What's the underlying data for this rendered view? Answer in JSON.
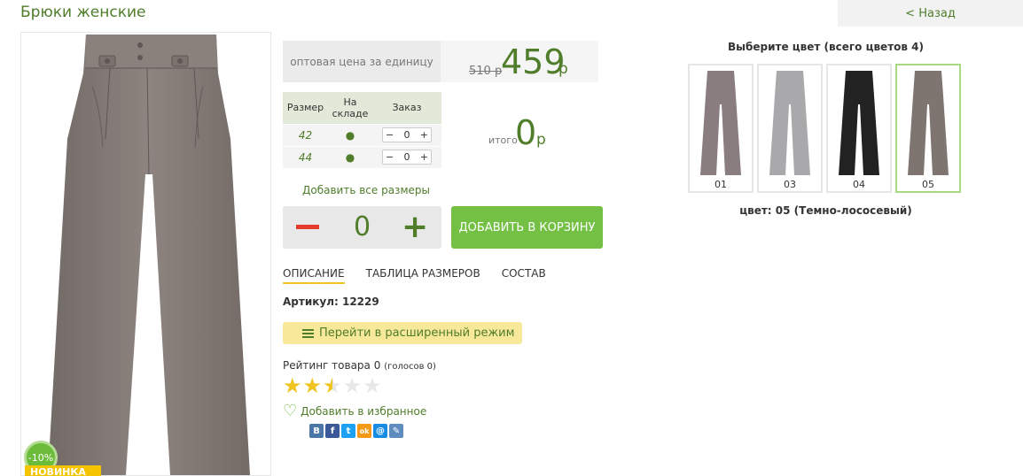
{
  "page": {
    "title": "Брюки женские",
    "back_label": "< Назад"
  },
  "product": {
    "discount": "-10%",
    "badge": "НОВИНКА",
    "price_label": "оптовая цена за единицу",
    "old_price": "510 р",
    "price": "459",
    "currency": "р",
    "article": "Артикул: 12229"
  },
  "size_table": {
    "headers": [
      "Размер",
      "На складе",
      "Заказ"
    ],
    "rows": [
      {
        "size": "42",
        "stock": "●",
        "qty": "0"
      },
      {
        "size": "44",
        "stock": "●",
        "qty": "0"
      }
    ]
  },
  "total": {
    "label": "итого",
    "value": "0",
    "currency": "р"
  },
  "add_all_label": "Добавить все размеры",
  "quantity": {
    "value": "0",
    "minus": "−",
    "plus": "+"
  },
  "cart_button": "ДОБАВИТЬ В КОРЗИНУ",
  "tabs": [
    {
      "label": "ОПИСАНИЕ",
      "active": true
    },
    {
      "label": "ТАБЛИЦА РАЗМЕРОВ",
      "active": false
    },
    {
      "label": "СОСТАВ",
      "active": false
    }
  ],
  "advanced_button": "Перейти в расширенный режим",
  "rating": {
    "label": "Рейтинг товара 0",
    "votes": "(голосов 0)",
    "stars": 2.5,
    "max": 5
  },
  "favorite_label": "Добавить в избранное",
  "share": [
    {
      "icon": "vk-icon",
      "glyph": "B",
      "color": "#4a76a8"
    },
    {
      "icon": "facebook-icon",
      "glyph": "f",
      "color": "#3b5998"
    },
    {
      "icon": "twitter-icon",
      "glyph": "t",
      "color": "#1da1f2"
    },
    {
      "icon": "odnoklassniki-icon",
      "glyph": "ok",
      "color": "#f59a17"
    },
    {
      "icon": "mailru-icon",
      "glyph": "@",
      "color": "#168de2"
    },
    {
      "icon": "livejournal-icon",
      "glyph": "✎",
      "color": "#5f8cbf"
    }
  ],
  "colors": {
    "title": "Выберите цвет (всего цветов 4)",
    "items": [
      {
        "code": "01",
        "hex": "#8a7d80"
      },
      {
        "code": "03",
        "hex": "#a9a9ab"
      },
      {
        "code": "04",
        "hex": "#222222"
      },
      {
        "code": "05",
        "hex": "#7f7570",
        "selected": true
      }
    ],
    "selected_label": "цвет: 05 (Темно-лососевый)"
  },
  "theme": {
    "accent_green": "#4f7d2a",
    "button_green": "#74c045",
    "star_yellow": "#f0c420"
  }
}
